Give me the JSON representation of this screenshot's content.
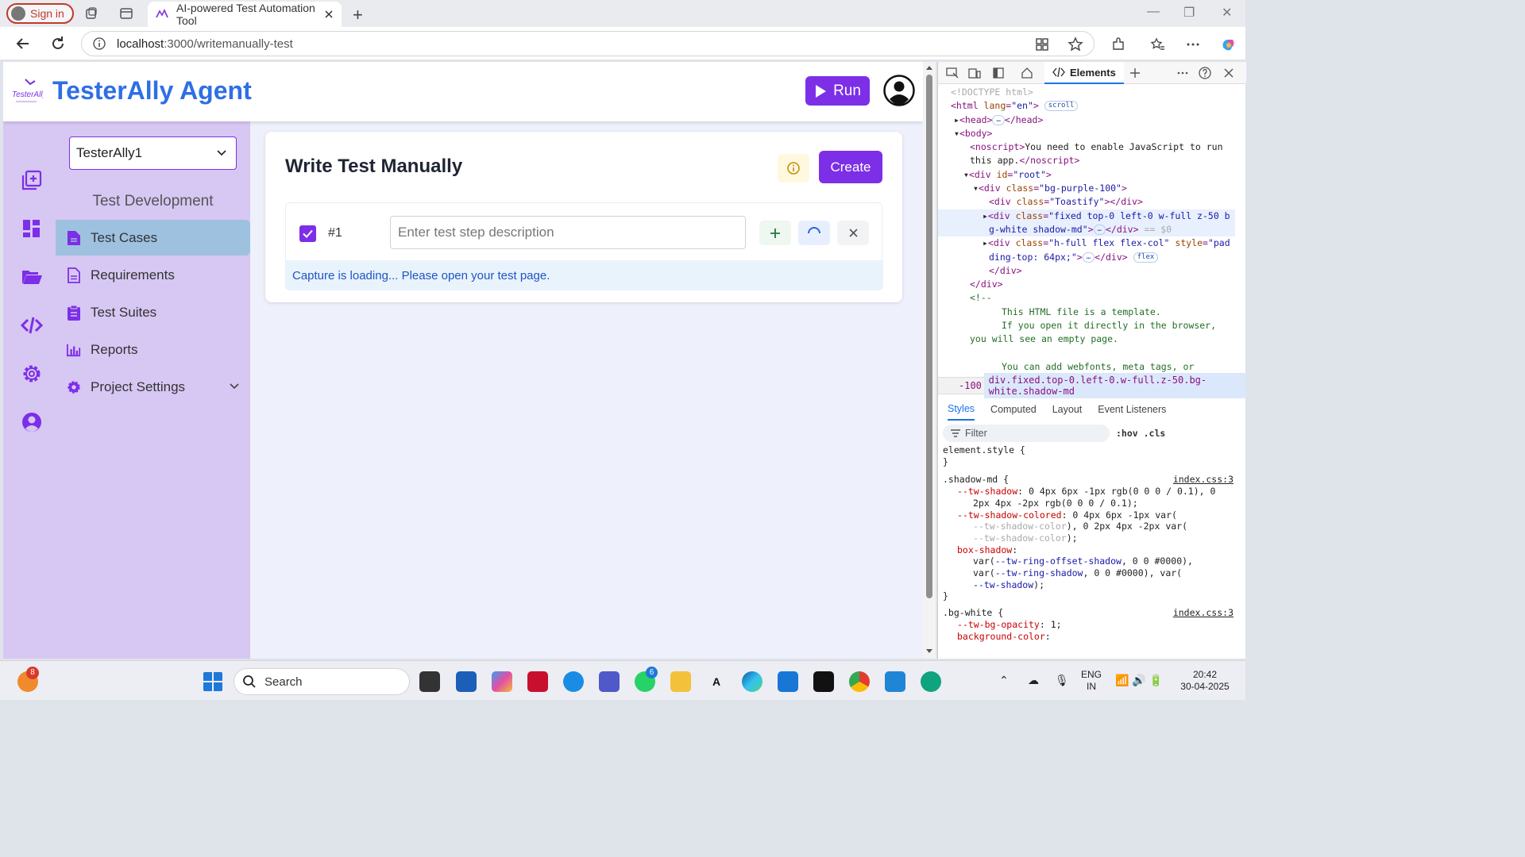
{
  "browser": {
    "signin_label": "Sign in",
    "tab_title": "AI-powered Test Automation Tool",
    "url_host": "localhost",
    "url_path": ":3000/writemanually-test"
  },
  "app": {
    "brand": "TesterAlly Agent",
    "logo_text": "TesterAlly",
    "run_label": "Run",
    "project": "TesterAlly1",
    "section_title": "Test Development",
    "nav": [
      {
        "label": "Test Cases"
      },
      {
        "label": "Requirements"
      },
      {
        "label": "Test Suites"
      },
      {
        "label": "Reports"
      },
      {
        "label": "Project Settings"
      }
    ],
    "page_title": "Write Test Manually",
    "create_label": "Create",
    "step_number": "#1",
    "step_placeholder": "Enter test step description",
    "capture_msg": "Capture is loading... Please open your test page."
  },
  "devtools": {
    "tab_label": "Elements",
    "crumb_left": "-100",
    "crumb_path": "div.fixed.top-0.left-0.w-full.z-50.bg-white.shadow-md",
    "style_tabs": [
      "Styles",
      "Computed",
      "Layout",
      "Event Listeners"
    ],
    "filter_placeholder": "Filter",
    "hov": ":hov .cls"
  },
  "taskbar": {
    "search_label": "Search",
    "lang1": "ENG",
    "lang2": "IN",
    "time": "20:42",
    "date": "30-04-2025",
    "badge_notify": "8",
    "badge_whatsapp": "6"
  },
  "colors": {
    "accent": "#7c2fe6",
    "brand": "#2f6fe4",
    "sidebar": "#d7c7f3",
    "active_nav": "#9ec1df"
  }
}
